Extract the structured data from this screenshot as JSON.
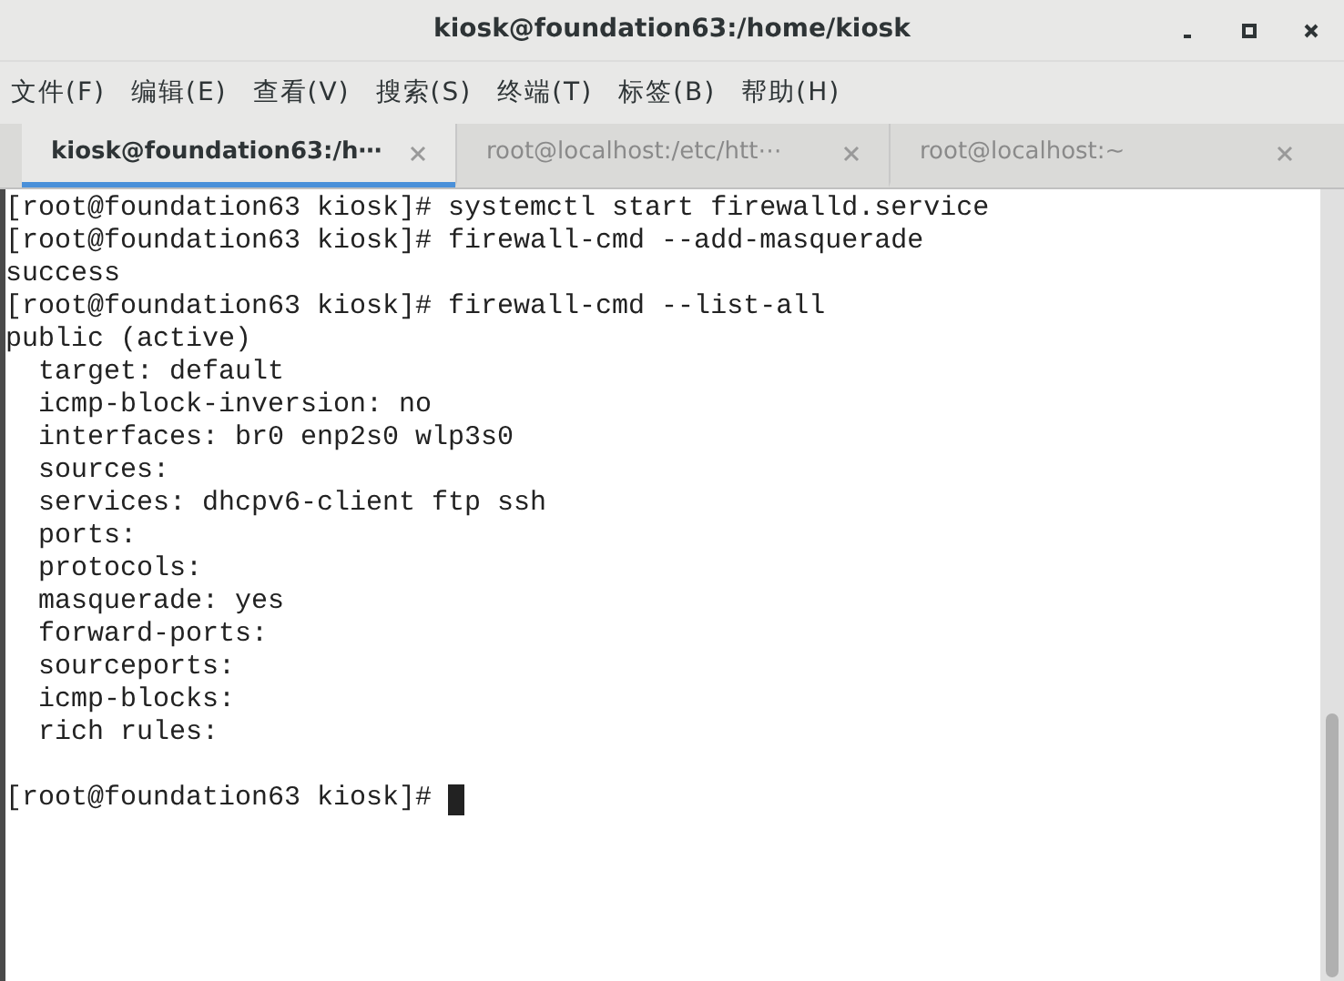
{
  "window": {
    "title": "kiosk@foundation63:/home/kiosk"
  },
  "menu": [
    "文件(F)",
    "编辑(E)",
    "查看(V)",
    "搜索(S)",
    "终端(T)",
    "标签(B)",
    "帮助(H)"
  ],
  "tabs": [
    {
      "label": "kiosk@foundation63:/h⋯",
      "selected": true
    },
    {
      "label": "root@localhost:/etc/htt⋯",
      "selected": false
    },
    {
      "label": "root@localhost:~",
      "selected": false
    }
  ],
  "terminal": {
    "lines": [
      {
        "kind": "text",
        "text": "[root@foundation63 kiosk]# systemctl start firewalld.service"
      },
      {
        "kind": "text",
        "text": "[root@foundation63 kiosk]# firewall-cmd --add-masquerade"
      },
      {
        "kind": "text",
        "text": "success"
      },
      {
        "kind": "text",
        "text": "[root@foundation63 kiosk]# firewall-cmd --list-all"
      },
      {
        "kind": "text",
        "text": "public (active)"
      },
      {
        "kind": "text",
        "text": "  target: default"
      },
      {
        "kind": "text",
        "text": "  icmp-block-inversion: no"
      },
      {
        "kind": "text",
        "text": "  interfaces: br0 enp2s0 wlp3s0"
      },
      {
        "kind": "text",
        "text": "  sources:"
      },
      {
        "kind": "text",
        "text": "  services: dhcpv6-client ftp ssh"
      },
      {
        "kind": "text",
        "text": "  ports:"
      },
      {
        "kind": "text",
        "text": "  protocols:"
      },
      {
        "kind": "text",
        "text": "  masquerade: yes"
      },
      {
        "kind": "text",
        "text": "  forward-ports:"
      },
      {
        "kind": "text",
        "text": "  sourceports:"
      },
      {
        "kind": "text",
        "text": "  icmp-blocks:"
      },
      {
        "kind": "text",
        "text": "  rich rules:"
      },
      {
        "kind": "blank"
      },
      {
        "kind": "prompt",
        "text": "[root@foundation63 kiosk]#",
        "cursor": true
      }
    ]
  }
}
